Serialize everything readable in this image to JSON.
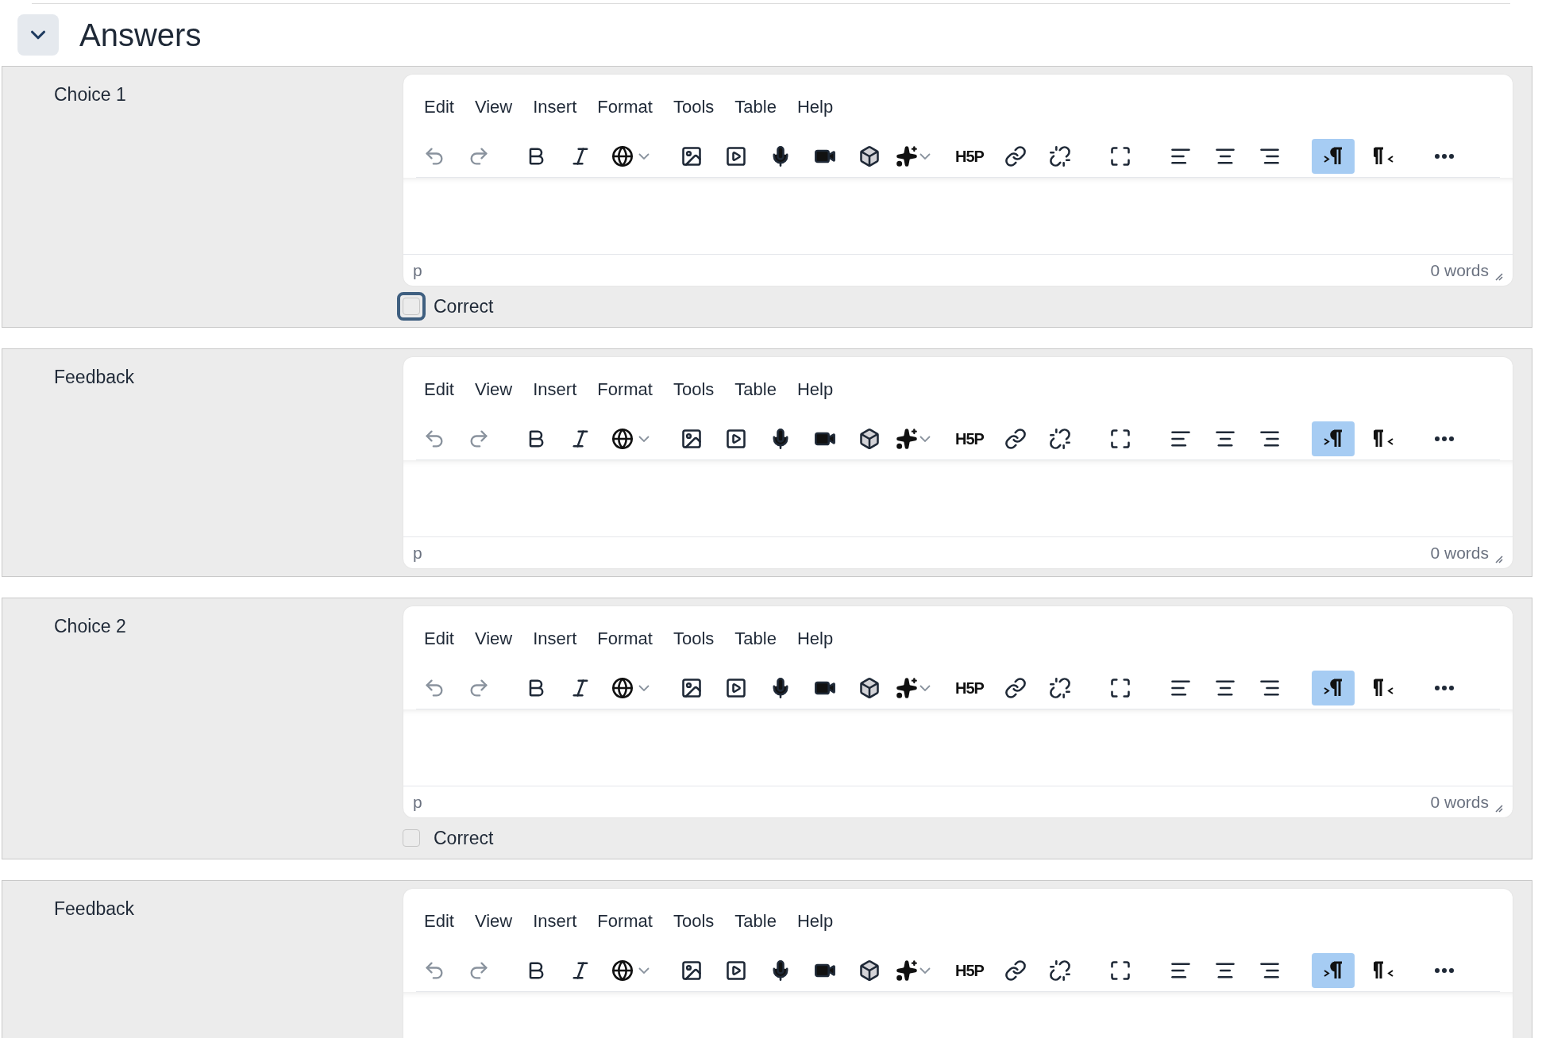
{
  "header": {
    "title": "Answers",
    "expanded": true
  },
  "sections": [
    {
      "label": "Choice 1",
      "editor": {
        "menu": [
          "Edit",
          "View",
          "Insert",
          "Format",
          "Tools",
          "Table",
          "Help"
        ],
        "history": [
          {
            "kind": "undo",
            "disabled": true
          },
          {
            "kind": "redo",
            "disabled": true
          }
        ],
        "plugin_label": "H5P",
        "direction": [
          {
            "kind": "ltr",
            "selected": true
          },
          {
            "kind": "rtl",
            "selected": false
          }
        ],
        "status": {
          "path": "p",
          "word_count": "0 words"
        }
      },
      "correct": {
        "label": "Correct",
        "checked": false,
        "focused": true
      }
    },
    {
      "label": "Feedback",
      "editor": {
        "menu": [
          "Edit",
          "View",
          "Insert",
          "Format",
          "Tools",
          "Table",
          "Help"
        ],
        "history": [
          {
            "kind": "undo",
            "disabled": true
          },
          {
            "kind": "redo",
            "disabled": true
          }
        ],
        "plugin_label": "H5P",
        "direction": [
          {
            "kind": "ltr",
            "selected": true
          },
          {
            "kind": "rtl",
            "selected": false
          }
        ],
        "status": {
          "path": "p",
          "word_count": "0 words"
        }
      }
    },
    {
      "label": "Choice 2",
      "editor": {
        "menu": [
          "Edit",
          "View",
          "Insert",
          "Format",
          "Tools",
          "Table",
          "Help"
        ],
        "history": [
          {
            "kind": "undo",
            "disabled": true
          },
          {
            "kind": "redo",
            "disabled": true
          }
        ],
        "plugin_label": "H5P",
        "direction": [
          {
            "kind": "ltr",
            "selected": true
          },
          {
            "kind": "rtl",
            "selected": false
          }
        ],
        "status": {
          "path": "p",
          "word_count": "0 words"
        }
      },
      "correct": {
        "label": "Correct",
        "checked": false,
        "focused": false
      }
    },
    {
      "label": "Feedback",
      "editor": {
        "menu": [
          "Edit",
          "View",
          "Insert",
          "Format",
          "Tools",
          "Table",
          "Help"
        ],
        "history": [
          {
            "kind": "undo",
            "disabled": true
          },
          {
            "kind": "redo",
            "disabled": true
          }
        ],
        "plugin_label": "H5P",
        "direction": [
          {
            "kind": "ltr",
            "selected": true
          },
          {
            "kind": "rtl",
            "selected": false
          }
        ]
      }
    }
  ]
}
